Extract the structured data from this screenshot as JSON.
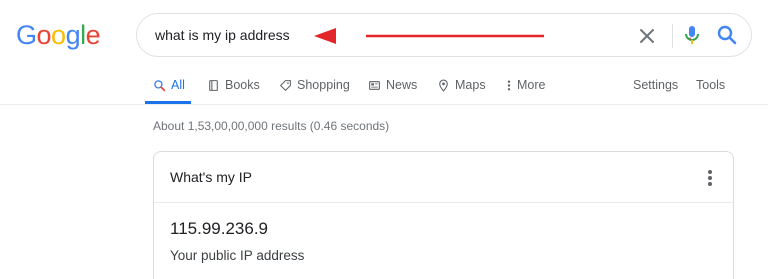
{
  "logo": {
    "letters": [
      "G",
      "o",
      "o",
      "g",
      "l",
      "e"
    ]
  },
  "colors": {
    "blue": "#4285F4",
    "red": "#EA4335",
    "yellow": "#FBBC05",
    "green": "#34A853",
    "accent": "#1a73e8",
    "annotation_arrow": "#e3262a"
  },
  "search": {
    "query": "what is my ip address"
  },
  "icons": {
    "clear": "close-icon",
    "voice": "mic-icon",
    "submit": "search-icon",
    "more": "more-vert-icon"
  },
  "tabs": [
    {
      "label": "All",
      "icon": "search-icon",
      "active": true
    },
    {
      "label": "Books",
      "icon": "book-icon"
    },
    {
      "label": "Shopping",
      "icon": "tag-icon"
    },
    {
      "label": "News",
      "icon": "newspaper-icon"
    },
    {
      "label": "Maps",
      "icon": "map-pin-icon"
    },
    {
      "label": "More",
      "icon": "dots-vertical-icon"
    }
  ],
  "tools": {
    "settings": "Settings",
    "tools": "Tools"
  },
  "results": {
    "stats": "About 1,53,00,00,000 results (0.46 seconds)"
  },
  "card": {
    "title": "What's my IP",
    "ip": "115.99.236.9",
    "caption": "Your public IP address"
  }
}
